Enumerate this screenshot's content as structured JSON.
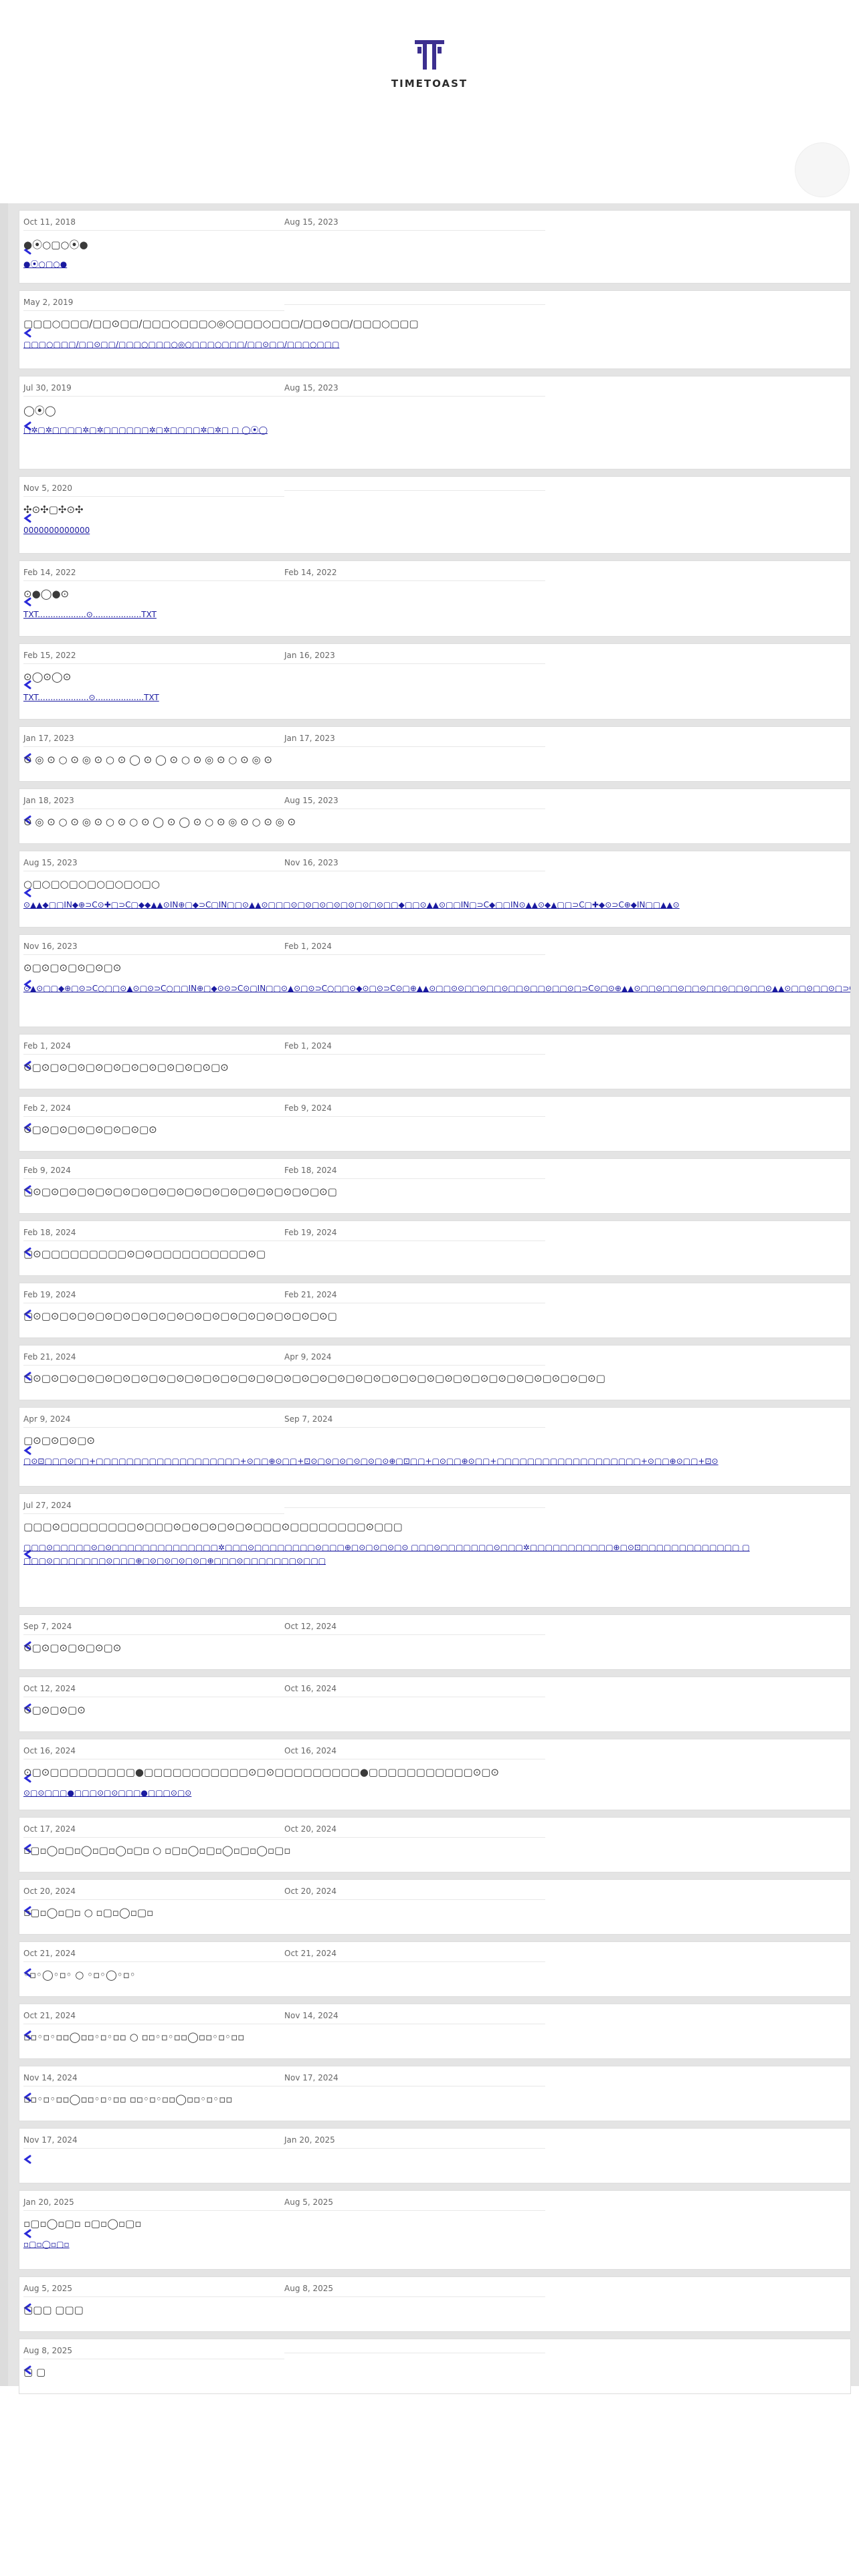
{
  "brand": {
    "name": "TIMETOAST"
  },
  "entries": [
    {
      "start": "Oct 11, 2018",
      "end": "Aug 15, 2023",
      "title": "●⦿○▢○⦿●",
      "link": "●⦿○▢○●"
    },
    {
      "start": "May 2, 2019",
      "end": "",
      "title": "▢▢▢○▢▢▢/▢▢⊙▢▢/▢▢▢○▢▢▢○◎○▢▢▢○▢▢▢/▢▢⊙▢▢/▢▢▢○▢▢▢",
      "link": "▢▢▢○▢▢▢/▢▢⊙▢▢/▢▢▢○▢▢▢○◎○▢▢▢○▢▢▢/▢▢⊙▢▢/▢▢▢○▢▢▢"
    },
    {
      "start": "Jul 30, 2019",
      "end": "Aug 15, 2023",
      "title": "◯⦿◯",
      "link": "▢✲▢✲▢▢▢▢✲▢✲▢▢▢▢▢▢✲▢✲▢▢▢▢✲▢✲▢ ▢ ◯⦿◯"
    },
    {
      "start": "Nov 5, 2020",
      "end": "",
      "title": "✣⊙✣▢✣⊙✣",
      "link": "0000000000000"
    },
    {
      "start": "Feb 14, 2022",
      "end": "Feb 14, 2022",
      "title": "⊙●◯●⊙",
      "link": "TXT...................⊙...................TXT"
    },
    {
      "start": "Feb 15, 2022",
      "end": "Jan 16, 2023",
      "title": "⊙◯⊙◯⊙",
      "link": "TXT....................⊙...................TXT"
    },
    {
      "start": "Jan 17, 2023",
      "end": "Jan 17, 2023",
      "title": "⊙ ◎ ⊙ ○ ⊙ ◎ ⊙ ○ ⊙ ◯ ⊙ ◯ ⊙ ○ ⊙ ◎ ⊙ ○ ⊙ ◎ ⊙",
      "link": ""
    },
    {
      "start": "Jan 18, 2023",
      "end": "Aug 15, 2023",
      "title": "⊙ ◎ ⊙ ○ ⊙ ◎ ⊙ ○ ⊙ ○ ⊙ ◯ ⊙ ◯ ⊙ ○ ⊙ ◎ ⊙ ○ ⊙ ◎ ⊙",
      "link": ""
    },
    {
      "start": "Aug 15, 2023",
      "end": "Nov 16, 2023",
      "title": "○▢○▢○▢○▢○▢○▢○▢○",
      "link": "⊙▲▲◆▢▢IN◆⊕⊃C⊙✚▢⊃C▢◆◆▲▲⊙IN⊕▢◆⊃C▢IN▢▢⊙▲▲⊙▢▢▢⊙▢⊙▢⊙▢⊙▢⊙▢⊙▢⊙▢▢◆▢▢⊙▲▲⊙▢▢IN▢⊃C◆▢▢IN⊙▲▲⊙◆▲▢▢⊃C▢✚◆⊙⊃C⊕◆IN▢▢▲▲⊙"
    },
    {
      "start": "Nov 16, 2023",
      "end": "Feb 1, 2024",
      "title": "⊙▢⊙▢⊙▢⊙▢⊙▢⊙",
      "link": "⊙▲⊙▢▢◆⊕▢⊙⊃C○▢▢⊙▲⊙▢⊙⊃C○▢▢IN⊕▢◆⊙⊙⊃C⊙▢IN▢▢⊙▲⊙▢⊙⊃C○▢▢⊙◆⊙▢⊙⊃C⊙▢⊕▲▲⊙▢▢⊙⊙▢▢⊙▢▢⊙▢▢⊙▢▢⊙▢▢⊙▢⊃C⊙▢⊙⊕▲▲⊙▢▢⊙▢▢⊙▢▢⊙▢▢⊙▢▢⊙▢▢⊙▲▲⊙▢▢⊙▢▢⊙▢⊃C▢▢⊙▢▢⊙▢⊃C⊙▢⊕▲▲⊙▢▢⊙▢▢⊙▢▢⊙▢▢⊙▢▢⊙▢▢⊙▢▢IN◆⊙⊃C⊕▢◆⊙⊕⊙◆◆⊙▲▲⊙▢"
    },
    {
      "start": "Feb 1, 2024",
      "end": "Feb 1, 2024",
      "title": "⊙▢⊙▢⊙▢⊙▢⊙▢⊙▢⊙▢⊙▢⊙▢⊙▢⊙▢⊙",
      "link": ""
    },
    {
      "start": "Feb 2, 2024",
      "end": "Feb 9, 2024",
      "title": "⊙▢⊙▢⊙▢⊙▢⊙▢⊙▢⊙▢⊙",
      "link": ""
    },
    {
      "start": "Feb 9, 2024",
      "end": "Feb 18, 2024",
      "title": "▢⊙▢⊙▢⊙▢⊙▢⊙▢⊙▢⊙▢⊙▢⊙▢⊙▢⊙▢⊙▢⊙▢⊙▢⊙▢⊙▢⊙▢",
      "link": ""
    },
    {
      "start": "Feb 18, 2024",
      "end": "Feb 19, 2024",
      "title": "▢⊙▢▢▢▢▢▢▢▢▢⊙▢⊙▢▢▢▢▢▢▢▢▢▢⊙▢",
      "link": ""
    },
    {
      "start": "Feb 19, 2024",
      "end": "Feb 21, 2024",
      "title": "▢⊙▢⊙▢⊙▢⊙▢⊙▢⊙▢⊙▢⊙▢⊙▢⊙▢⊙▢⊙▢⊙▢⊙▢⊙▢⊙▢⊙▢",
      "link": ""
    },
    {
      "start": "Feb 21, 2024",
      "end": "Apr 9, 2024",
      "title": "▢⊙▢⊙▢⊙▢⊙▢⊙▢⊙▢⊙▢⊙▢⊙▢⊙▢⊙▢⊙▢⊙▢⊙▢⊙▢⊙▢⊙▢⊙▢⊙▢⊙▢⊙▢⊙▢⊙▢⊙▢⊙▢⊙▢⊙▢⊙▢⊙▢⊙▢⊙▢⊙▢",
      "link": ""
    },
    {
      "start": "Apr 9, 2024",
      "end": "Sep 7, 2024",
      "title": "▢⊙▢⊙▢⊙▢⊙",
      "link": "▢⊙⊡▢▢▢⊙▢▢+▢▢▢▢▢▢▢▢▢▢▢▢▢▢▢▢▢▢▢+⊙▢▢⊕⊙▢▢+⊡⊙▢⊙▢⊙▢⊙▢⊙▢⊙⊕▢⊡▢▢+▢⊙▢▢⊕⊙▢▢+▢▢▢▢▢▢▢▢▢▢▢▢▢▢▢▢▢▢▢+⊙▢▢⊕⊙▢▢+⊡⊙"
    },
    {
      "start": "Jul 27, 2024",
      "end": "",
      "title": "▢▢▢⊙▢▢▢▢▢▢▢▢⊙▢▢▢⊙▢⊙▢⊙▢⊙▢⊙▢▢▢⊙▢▢▢▢▢▢▢▢⊙▢▢▢",
      "link": "▢▢▢⊙▢▢▢▢▢⊙▢⊙▢▢▢▢▢▢▢▢▢▢▢▢▢▢✲▢▢▢⊙▢▢▢▢▢▢▢▢⊙▢▢▢⊕▢⊙▢⊙▢⊙▢⊙ ▢▢▢⊙▢▢▢▢▢▢▢⊙▢▢▢✲▢▢▢▢▢▢▢▢▢▢▢⊕▢⊙⊡▢▢▢▢▢▢▢▢▢▢▢▢▢ ▢ ▢▢▢⊙▢▢▢▢▢▢▢⊙▢▢▢⊕▢⊙▢⊙▢⊙▢⊙▢⊕▢▢▢⊙▢▢▢▢▢▢▢⊙▢▢▢"
    },
    {
      "start": "Sep 7, 2024",
      "end": "Oct 12, 2024",
      "title": "⊙▢⊙▢⊙▢⊙▢⊙▢⊙",
      "link": ""
    },
    {
      "start": "Oct 12, 2024",
      "end": "Oct 16, 2024",
      "title": "⊙▢⊙▢⊙▢⊙",
      "link": ""
    },
    {
      "start": "Oct 16, 2024",
      "end": "Oct 16, 2024",
      "title": "⊙▢⊙▢▢▢▢▢▢▢▢▢●▢▢▢▢▢▢▢▢▢▢▢⊙▢⊙▢▢▢▢▢▢▢▢▢●▢▢▢▢▢▢▢▢▢▢▢⊙▢⊙",
      "link": "⊙▢⊙▢▢▢●▢▢▢⊙▢⊙▢▢▢●▢▢▢⊙▢⊙"
    },
    {
      "start": "Oct 17, 2024",
      "end": "Oct 20, 2024",
      "title": "▫▢▫◯▫▢▫◯▫▢▫◯▫▢▫        ○        ▫▢▫◯▫▢▫◯▫▢▫◯▫▢▫",
      "link": ""
    },
    {
      "start": "Oct 20, 2024",
      "end": "Oct 20, 2024",
      "title": "▫▢▫◯▫▢▫      ○      ▫▢▫◯▫▢▫",
      "link": ""
    },
    {
      "start": "Oct 21, 2024",
      "end": "Oct 21, 2024",
      "title": "◦▫◦◯◦▫◦       ○       ◦▫◦◯◦▫◦",
      "link": ""
    },
    {
      "start": "Oct 21, 2024",
      "end": "Nov 14, 2024",
      "title": "▫▫◦▫◦▫▫◯▫▫◦▫◦▫▫            ○            ▫▫◦▫◦▫▫◯▫▫◦▫◦▫▫",
      "link": ""
    },
    {
      "start": "Nov 14, 2024",
      "end": "Nov 17, 2024",
      "title": "▫▫◦▫◦▫▫◯▫▫◦▫◦▫▫                          ▫▫◦▫◦▫▫◯▫▫◦▫◦▫▫",
      "link": ""
    },
    {
      "start": "Nov 17, 2024",
      "end": "Jan 20, 2025",
      "title": "",
      "link": ""
    },
    {
      "start": "Jan 20, 2025",
      "end": "Aug 5, 2025",
      "title": "▫▢▫◯▫▢▫           ▫▢▫◯▫▢▫",
      "link": "▫▢▫◯▫▢▫"
    },
    {
      "start": "Aug 5, 2025",
      "end": "Aug 8, 2025",
      "title": "▢▢▢   ▢▢▢",
      "link": ""
    },
    {
      "start": "Aug 8, 2025",
      "end": "",
      "title": "▢   ▢",
      "link": ""
    }
  ]
}
